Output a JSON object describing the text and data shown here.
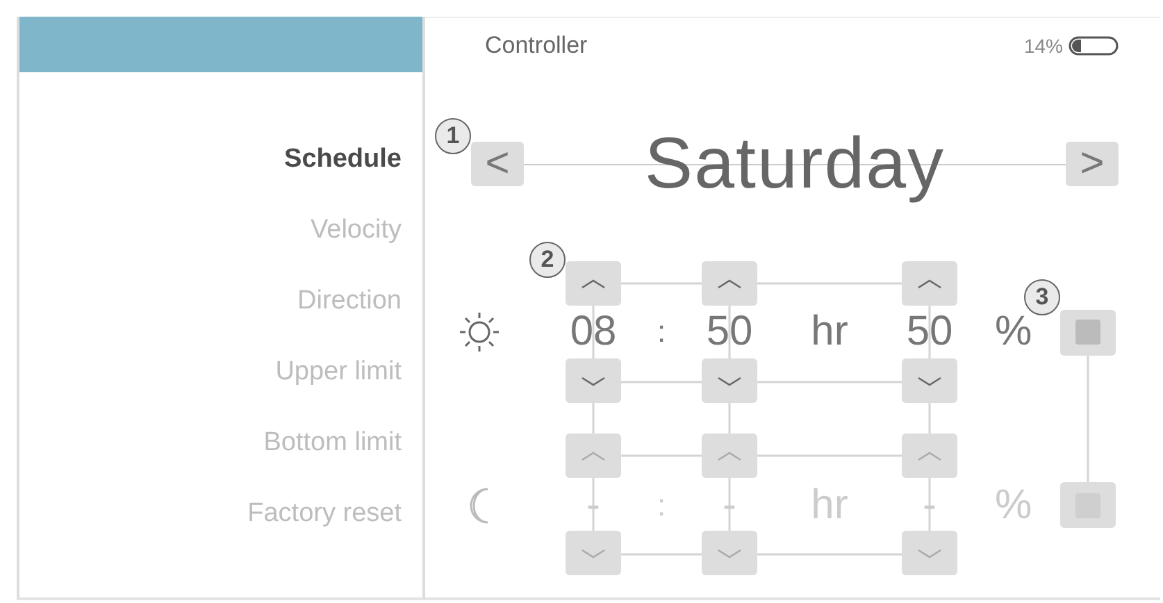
{
  "header": {
    "title": "Controller",
    "battery_text": "14%"
  },
  "sidebar": {
    "items": [
      {
        "label": "Schedule",
        "selected": true
      },
      {
        "label": "Velocity",
        "selected": false
      },
      {
        "label": "Direction",
        "selected": false
      },
      {
        "label": "Upper limit",
        "selected": false
      },
      {
        "label": "Bottom limit",
        "selected": false
      },
      {
        "label": "Factory reset",
        "selected": false
      }
    ]
  },
  "day_nav": {
    "prev": "<",
    "day": "Saturday",
    "next": ">"
  },
  "schedule_rows": [
    {
      "kind": "day",
      "enabled": true,
      "hour": "08",
      "separator": ":",
      "minute": "50",
      "unit": "hr",
      "percent": "50",
      "percent_sign": "%"
    },
    {
      "kind": "night",
      "enabled": false,
      "hour": "-",
      "separator": ":",
      "minute": "-",
      "unit": "hr",
      "percent": "-",
      "percent_sign": "%"
    }
  ],
  "callouts": [
    {
      "label": "1"
    },
    {
      "label": "2"
    },
    {
      "label": "3"
    }
  ]
}
